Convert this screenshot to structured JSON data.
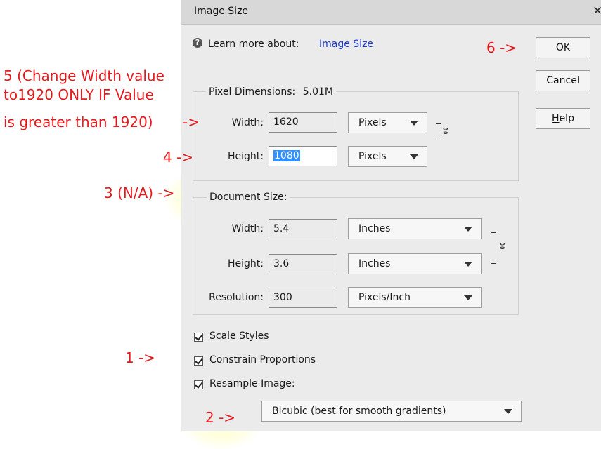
{
  "dialog": {
    "title": "Image Size",
    "close_glyph": "✕",
    "learn_prefix": "Learn more about:",
    "learn_link": "Image Size",
    "help_glyph": "?"
  },
  "buttons": {
    "ok": "OK",
    "cancel": "Cancel",
    "help": "Help"
  },
  "pixel_dimensions": {
    "legend": "Pixel Dimensions:",
    "size": "5.01M",
    "width_label": "Width:",
    "width_value": "1620",
    "width_unit": "Pixels",
    "height_label": "Height:",
    "height_value": "1080",
    "height_unit": "Pixels"
  },
  "document_size": {
    "legend": "Document Size:",
    "width_label": "Width:",
    "width_value": "5.4",
    "width_unit": "Inches",
    "height_label": "Height:",
    "height_value": "3.6",
    "height_unit": "Inches",
    "resolution_label": "Resolution:",
    "resolution_value": "300",
    "resolution_unit": "Pixels/Inch"
  },
  "options": {
    "scale_styles": "Scale Styles",
    "constrain": "Constrain Proportions",
    "resample": "Resample Image:",
    "resample_method": "Bicubic (best for smooth gradients)"
  },
  "annotations": {
    "a5_line1": "5 (Change Width value",
    "a5_line2": "to1920 ONLY IF Value",
    "a5_line3": "is greater than 1920)",
    "a5_arrow": "->",
    "a4": "4 ->",
    "a3": "3 (N/A) ->",
    "a1": "1 ->",
    "a2": "2 ->",
    "a6": "6 ->"
  },
  "colors": {
    "annotation": "#e8191c",
    "link": "#1a3bd1",
    "selection": "#3390ff"
  }
}
